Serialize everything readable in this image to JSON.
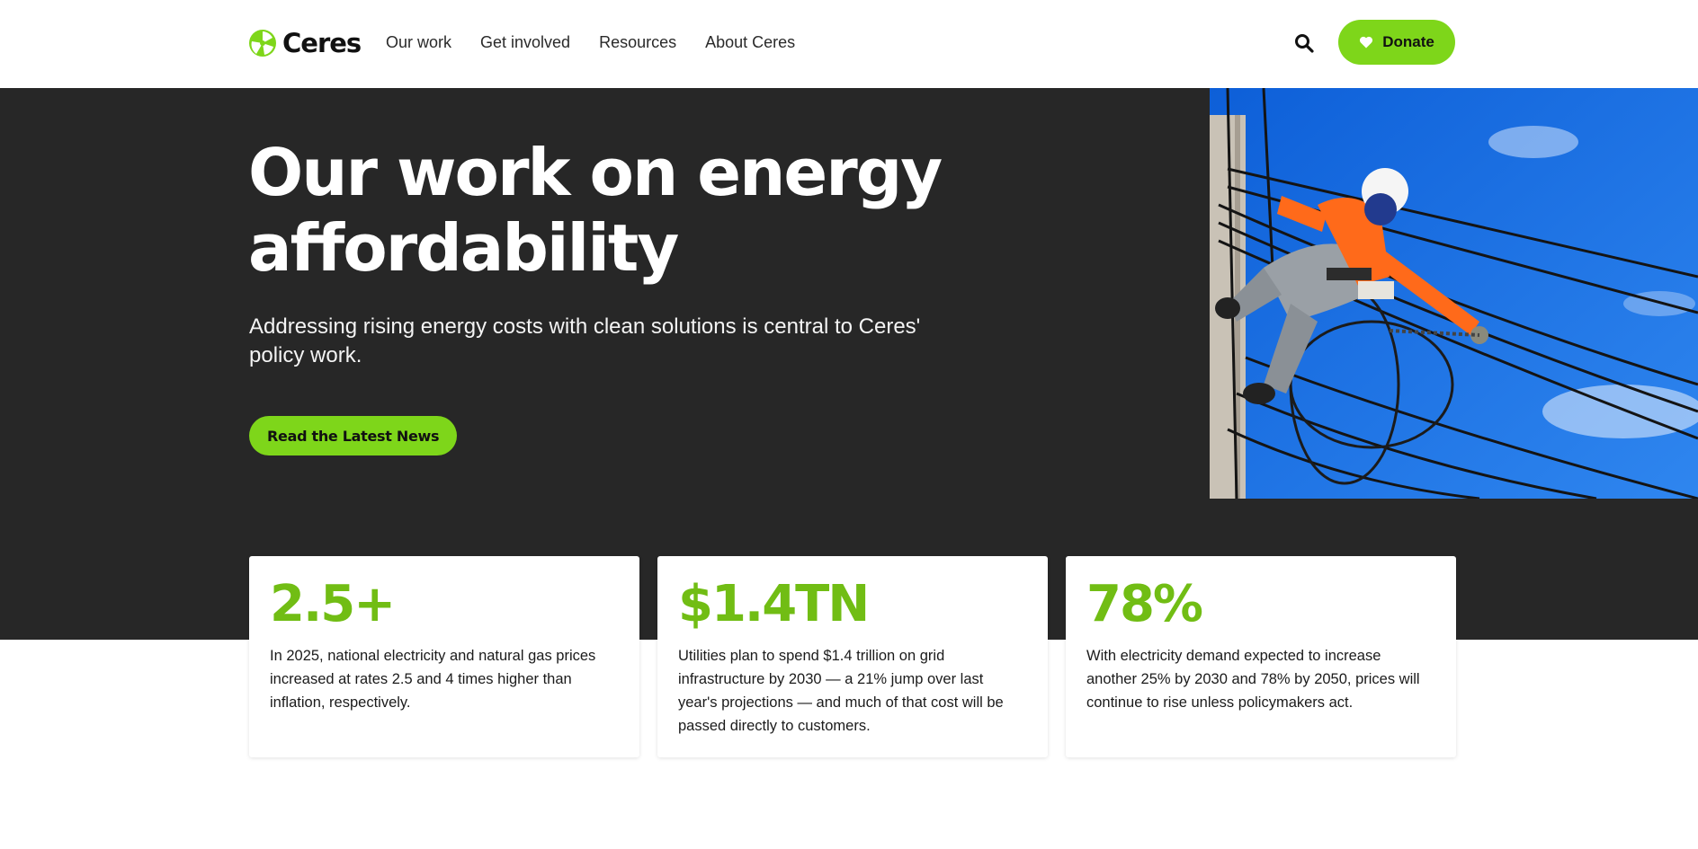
{
  "brand": {
    "name": "Ceres",
    "accent_color": "#7ed61a",
    "stat_color": "#71bd14",
    "hero_bg": "#272727"
  },
  "nav": {
    "items": [
      {
        "label": "Our work"
      },
      {
        "label": "Get involved"
      },
      {
        "label": "Resources"
      },
      {
        "label": "About Ceres"
      }
    ]
  },
  "header": {
    "search_icon": "search-icon",
    "donate_label": "Donate",
    "donate_icon": "heart-icon"
  },
  "hero": {
    "title": "Our work on energy affordability",
    "subtitle": "Addressing rising energy costs with clean solutions is central to Ceres' policy work.",
    "cta_label": "Read the Latest News",
    "image_subject": "lineman-on-power-pole"
  },
  "stats": [
    {
      "value": "2.5+",
      "text": "In 2025, national electricity and natural gas prices increased at rates 2.5 and 4 times higher than inflation, respectively."
    },
    {
      "value": "$1.4TN",
      "text": "Utilities plan to spend $1.4 trillion on grid infrastructure by 2030 — a 21% jump over last year's projections — and much of that cost will be passed directly to customers."
    },
    {
      "value": "78%",
      "text": "With electricity demand expected to increase another 25% by 2030 and 78% by 2050, prices will continue to rise unless policymakers act."
    }
  ]
}
